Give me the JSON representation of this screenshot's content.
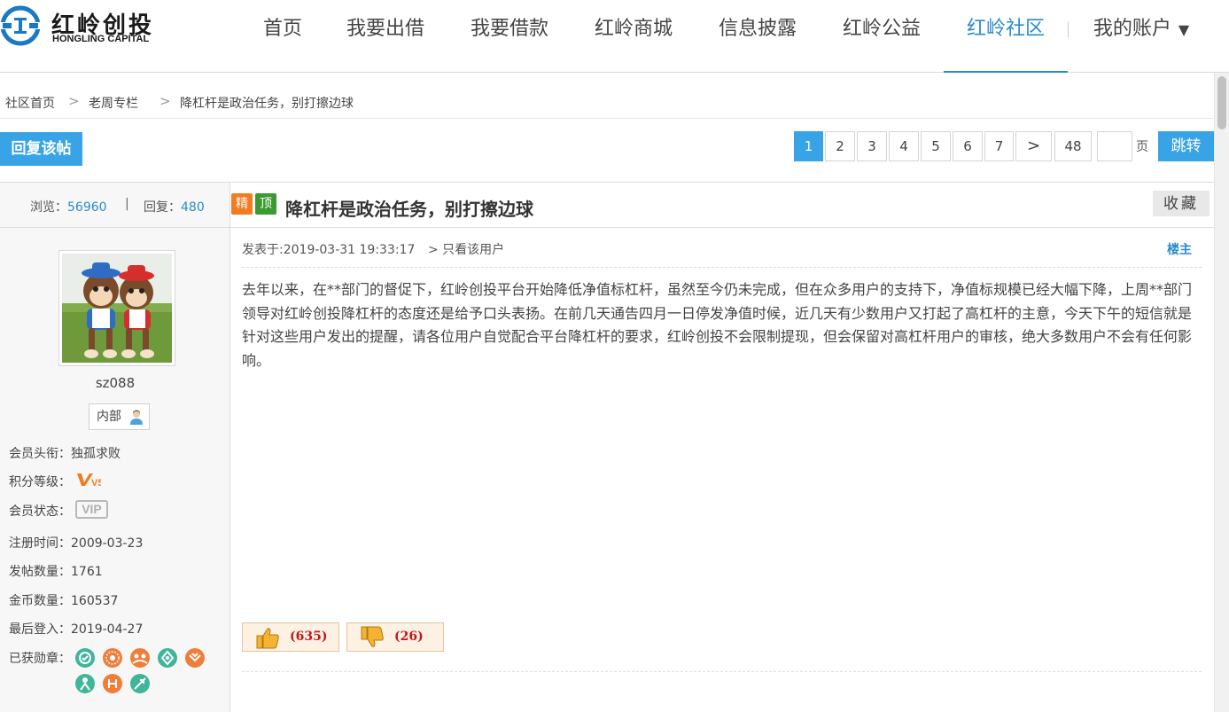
{
  "logo": {
    "name_cn": "红岭创投",
    "name_en": "HONGLING CAPITAL"
  },
  "nav": {
    "items": [
      "首页",
      "我要出借",
      "我要借款",
      "红岭商城",
      "信息披露",
      "红岭公益",
      "红岭社区"
    ],
    "active": "红岭社区",
    "account": "我的账户",
    "account_caret": "▼"
  },
  "breadcrumb": {
    "items": [
      "社区首页",
      "老周专栏",
      "降杠杆是政治任务，别打擦边球"
    ],
    "separator": ">"
  },
  "actions": {
    "reply": "回复该帖",
    "favorite": "收藏"
  },
  "pagination": {
    "pages": [
      "1",
      "2",
      "3",
      "4",
      "5",
      "6",
      "7"
    ],
    "next": ">",
    "last": "48",
    "current": "1",
    "unit": "页",
    "jump": "跳转",
    "input_value": ""
  },
  "stats": {
    "views_label": "浏览：",
    "views": "56960",
    "divider": "|",
    "replies_label": "回复：",
    "replies": "480"
  },
  "post": {
    "tags": [
      "精",
      "顶"
    ],
    "title": "降杠杆是政治任务，别打擦边球",
    "posted_label": "发表于:2019-03-31 19:33:17",
    "only_user": "> 只看该用户",
    "floor": "楼主",
    "content": "去年以来，在**部门的督促下，红岭创投平台开始降低净值标杠杆，虽然至今仍未完成，但在众多用户的支持下，净值标规模已经大幅下降，上周**部门领导对红岭创投降杠杆的态度还是给予口头表扬。在前几天通告四月一日停发净值时候，近几天有少数用户又打起了高杠杆的主意，今天下午的短信就是针对这些用户发出的提醒，请各位用户自觉配合平台降杠杆的要求，红岭创投不会限制提现，但会保留对高杠杆用户的审核，绝大多数用户不会有任何影响。",
    "like_count": "(635)",
    "dislike_count": "(26)"
  },
  "author": {
    "username": "sz088",
    "role": "内部",
    "title_label": "会员头衔：",
    "title": "独孤求败",
    "level_label": "积分等级：",
    "level_badge": "V5",
    "status_label": "会员状态：",
    "status": "VIP",
    "register_label": "注册时间：",
    "register_date": "2009-03-23",
    "posts_label": "发帖数量：",
    "posts": "1761",
    "coins_label": "金币数量：",
    "coins": "160537",
    "last_login_label": "最后登入：",
    "last_login": "2019-04-27",
    "medals_label": "已获勋章：",
    "medals": [
      "medal-1",
      "medal-2",
      "medal-3",
      "medal-4",
      "medal-5",
      "medal-6",
      "medal-7",
      "medal-8"
    ]
  },
  "colors": {
    "accent": "#38a3e6",
    "link": "#2a8ccc",
    "tag_jing": "#f07d22",
    "tag_ding": "#3c9a32",
    "vote_text": "#c8131a",
    "medal_green": "#3fb59a",
    "medal_orange": "#f07d3a"
  }
}
